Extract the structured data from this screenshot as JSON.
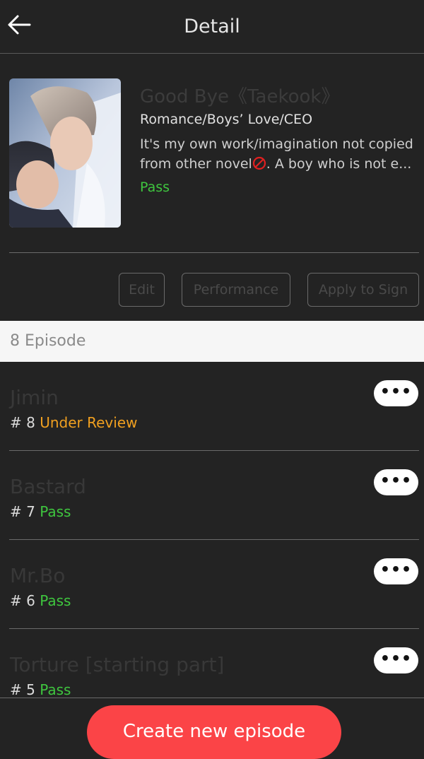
{
  "header": {
    "title": "Detail",
    "back_icon": "arrow-left-icon"
  },
  "book": {
    "title": "Good Bye《Taekook》",
    "genre": "Romance/Boys’ Love/CEO",
    "description_line1": "It's my own work/imagination not copied",
    "description_line2_prefix": "from other novel",
    "description_icon": "prohibited-icon",
    "description_line2_suffix": ". A boy who is not e...",
    "status": "Pass",
    "actions": {
      "edit": "Edit",
      "performance": "Performance",
      "apply_to_sign": "Apply to Sign"
    }
  },
  "episodes_header": {
    "count_label": "8 Episode"
  },
  "episodes": [
    {
      "title": "Jimin",
      "number": "# 8",
      "status": "Under Review",
      "more": "•••"
    },
    {
      "title": "Bastard",
      "number": "# 7",
      "status": "Pass",
      "more": "•••"
    },
    {
      "title": "Mr.Bo",
      "number": "# 6",
      "status": "Pass",
      "more": "•••"
    },
    {
      "title": "Torture [starting part]",
      "number": "# 5",
      "status": "Pass",
      "more": "•••"
    }
  ],
  "footer": {
    "create_label": "Create new episode"
  },
  "colors": {
    "background": "#232323",
    "accent": "#fb4447",
    "pass": "#3fc63f",
    "review": "#f0a020"
  }
}
